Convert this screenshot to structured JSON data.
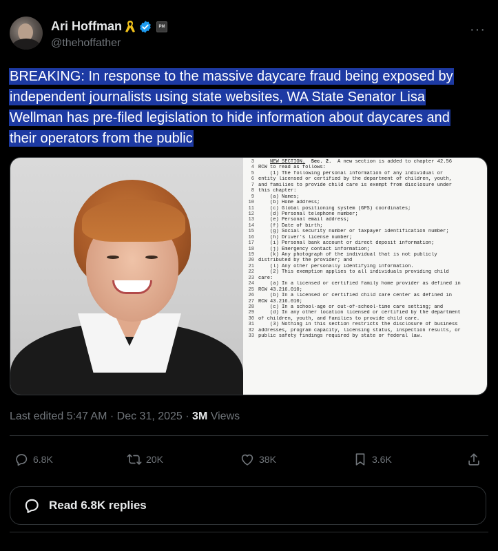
{
  "author": {
    "name": "Ari Hoffman",
    "handle": "@thehoffather",
    "affiliation_badge": "PM",
    "icons": [
      "yellow-ribbon-icon",
      "verified-badge-icon",
      "affiliation-badge-icon"
    ]
  },
  "tweet": {
    "text_lines": [
      "BREAKING: In response to the massive daycare fraud being exposed by",
      "independent journalists using state websites, WA State Senator Lisa",
      "Wellman has pre-filed legislation to hide information about daycares and",
      "their operators from the public"
    ],
    "highlight_color": "#1d3aa3"
  },
  "document": {
    "lines": [
      {
        "n": "3",
        "t": "    NEW SECTION.  Sec. 2.  A new section is added to chapter 42.56"
      },
      {
        "n": "4",
        "t": "RCW to read as follows:"
      },
      {
        "n": "5",
        "t": "    (1) The following personal information of any individual or"
      },
      {
        "n": "6",
        "t": "entity licensed or certified by the department of children, youth,"
      },
      {
        "n": "7",
        "t": "and families to provide child care is exempt from disclosure under"
      },
      {
        "n": "8",
        "t": "this chapter:"
      },
      {
        "n": "9",
        "t": "    (a) Names;"
      },
      {
        "n": "10",
        "t": "    (b) Home address;"
      },
      {
        "n": "11",
        "t": "    (c) Global positioning system (GPS) coordinates;"
      },
      {
        "n": "12",
        "t": "    (d) Personal telephone number;"
      },
      {
        "n": "13",
        "t": "    (e) Personal email address;"
      },
      {
        "n": "14",
        "t": "    (f) Date of birth;"
      },
      {
        "n": "15",
        "t": "    (g) Social security number or taxpayer identification number;"
      },
      {
        "n": "16",
        "t": "    (h) Driver's license number;"
      },
      {
        "n": "17",
        "t": "    (i) Personal bank account or direct deposit information;"
      },
      {
        "n": "18",
        "t": "    (j) Emergency contact information;"
      },
      {
        "n": "19",
        "t": "    (k) Any photograph of the individual that is not publicly"
      },
      {
        "n": "20",
        "t": "distributed by the provider; and"
      },
      {
        "n": "21",
        "t": "    (l) Any other personally identifying information."
      },
      {
        "n": "22",
        "t": "    (2) This exemption applies to all individuals providing child"
      },
      {
        "n": "23",
        "t": "care:"
      },
      {
        "n": "24",
        "t": "    (a) In a licensed or certified family home provider as defined in"
      },
      {
        "n": "25",
        "t": "RCW 43.216.010;"
      },
      {
        "n": "26",
        "t": "    (b) In a licensed or certified child care center as defined in"
      },
      {
        "n": "27",
        "t": "RCW 43.216.010;"
      },
      {
        "n": "28",
        "t": "    (c) In a school-age or out-of-school-time care setting; and"
      },
      {
        "n": "29",
        "t": "    (d) In any other location licensed or certified by the department"
      },
      {
        "n": "30",
        "t": "of children, youth, and families to provide child care."
      },
      {
        "n": "31",
        "t": "    (3) Nothing in this section restricts the disclosure of business"
      },
      {
        "n": "32",
        "t": "addresses, program capacity, licensing status, inspection results, or"
      },
      {
        "n": "33",
        "t": "public safety findings required by state or federal law."
      }
    ]
  },
  "meta": {
    "edited": "Last edited 5:47 AM · Dec 31, 2025 · ",
    "views_count": "3M",
    "views_label": " Views"
  },
  "actions": {
    "replies": "6.8K",
    "reposts": "20K",
    "likes": "38K",
    "bookmarks": "3.6K"
  },
  "read_replies": "Read 6.8K replies",
  "more_label": "···"
}
